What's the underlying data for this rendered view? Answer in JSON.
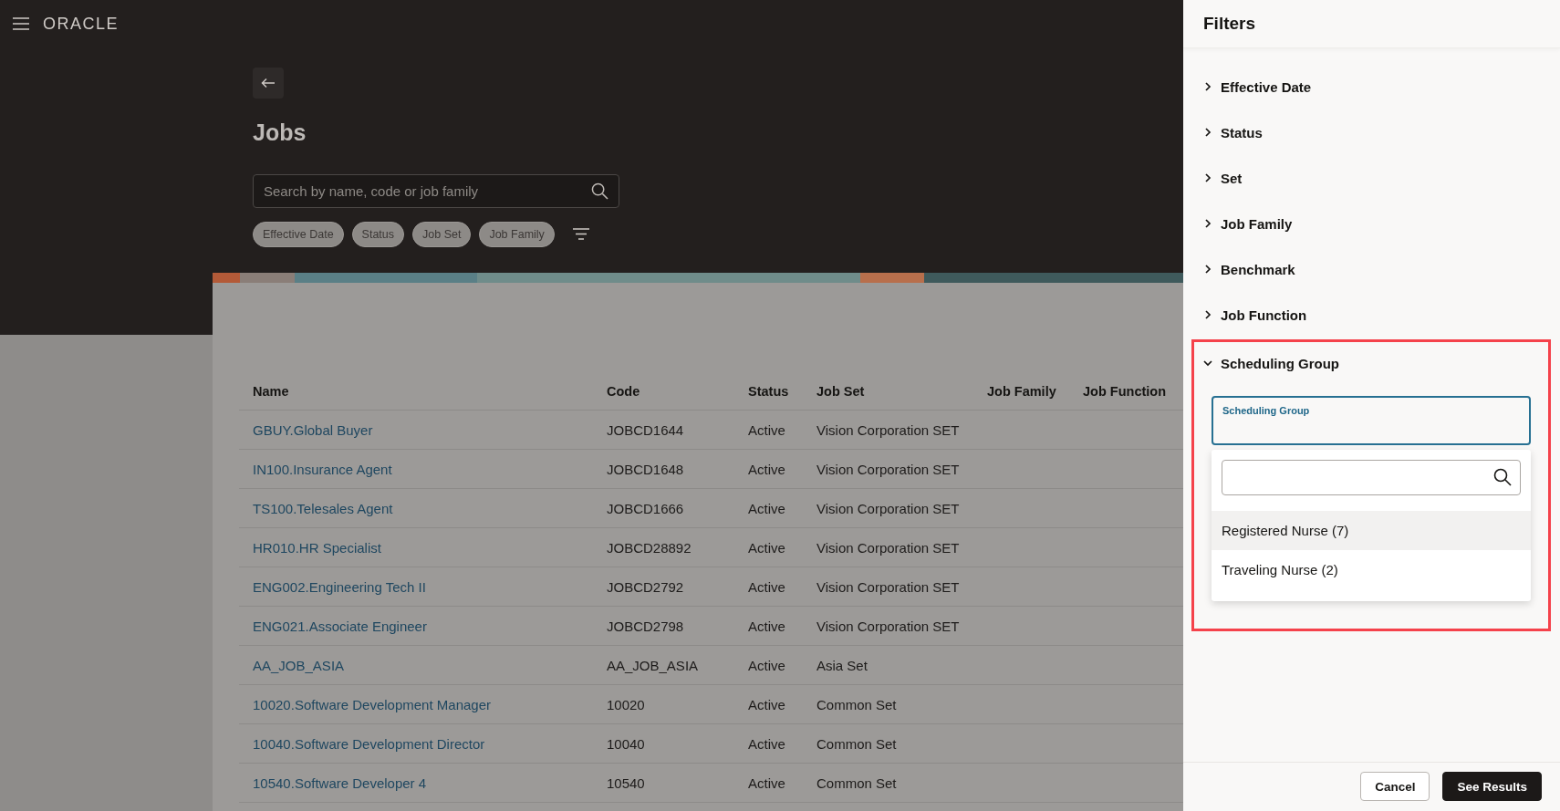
{
  "header": {
    "logo": "ORACLE"
  },
  "page": {
    "title": "Jobs",
    "search": {
      "placeholder": "Search by name, code or job family"
    },
    "chips": [
      "Effective Date",
      "Status",
      "Job Set",
      "Job Family"
    ]
  },
  "table": {
    "columns": [
      "Name",
      "Code",
      "Status",
      "Job Set",
      "Job Family",
      "Job Function"
    ],
    "rows": [
      {
        "name": "GBUY.Global Buyer",
        "code": "JOBCD1644",
        "status": "Active",
        "job_set": "Vision Corporation SET"
      },
      {
        "name": "IN100.Insurance Agent",
        "code": "JOBCD1648",
        "status": "Active",
        "job_set": "Vision Corporation SET"
      },
      {
        "name": "TS100.Telesales Agent",
        "code": "JOBCD1666",
        "status": "Active",
        "job_set": "Vision Corporation SET"
      },
      {
        "name": "HR010.HR Specialist",
        "code": "JOBCD28892",
        "status": "Active",
        "job_set": "Vision Corporation SET"
      },
      {
        "name": "ENG002.Engineering Tech II",
        "code": "JOBCD2792",
        "status": "Active",
        "job_set": "Vision Corporation SET"
      },
      {
        "name": "ENG021.Associate Engineer",
        "code": "JOBCD2798",
        "status": "Active",
        "job_set": "Vision Corporation SET"
      },
      {
        "name": "AA_JOB_ASIA",
        "code": "AA_JOB_ASIA",
        "status": "Active",
        "job_set": "Asia Set"
      },
      {
        "name": "10020.Software Development Manager",
        "code": "10020",
        "status": "Active",
        "job_set": "Common Set"
      },
      {
        "name": "10040.Software Development Director",
        "code": "10040",
        "status": "Active",
        "job_set": "Common Set"
      },
      {
        "name": "10540.Software Developer 4",
        "code": "10540",
        "status": "Active",
        "job_set": "Common Set"
      }
    ]
  },
  "filters": {
    "title": "Filters",
    "sections": [
      {
        "label": "Effective Date",
        "expanded": false,
        "highlighted": false
      },
      {
        "label": "Status",
        "expanded": false,
        "highlighted": false
      },
      {
        "label": "Set",
        "expanded": false,
        "highlighted": false
      },
      {
        "label": "Job Family",
        "expanded": false,
        "highlighted": false
      },
      {
        "label": "Benchmark",
        "expanded": false,
        "highlighted": false
      },
      {
        "label": "Job Function",
        "expanded": false,
        "highlighted": false
      },
      {
        "label": "Scheduling Group",
        "expanded": true,
        "highlighted": true,
        "field_label": "Scheduling Group",
        "options": [
          {
            "label": "Registered Nurse (7)",
            "highlighted": true
          },
          {
            "label": "Traveling Nurse (2)",
            "highlighted": false
          }
        ]
      }
    ],
    "buttons": [
      {
        "label": "Cancel",
        "kind": "secondary"
      },
      {
        "label": "See Results",
        "kind": "primary"
      }
    ]
  }
}
